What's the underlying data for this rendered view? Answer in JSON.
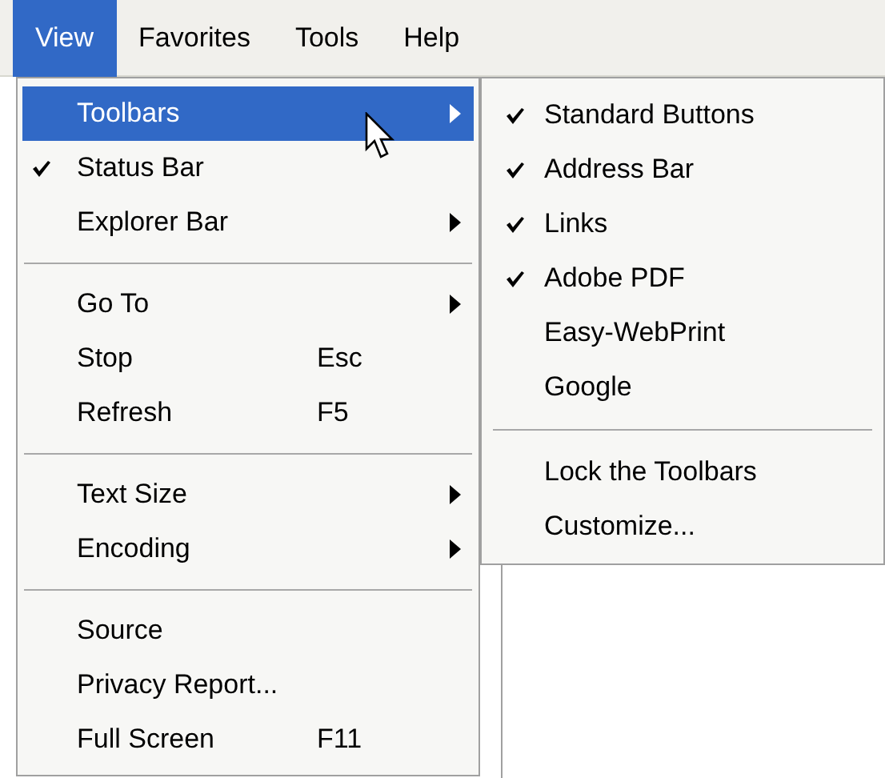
{
  "menubar": [
    {
      "label": "View",
      "selected": true
    },
    {
      "label": "Favorites",
      "selected": false
    },
    {
      "label": "Tools",
      "selected": false
    },
    {
      "label": "Help",
      "selected": false
    }
  ],
  "menu": {
    "sections": [
      [
        {
          "label": "Toolbars",
          "selected": true,
          "checked": false,
          "submenu": true
        },
        {
          "label": "Status Bar",
          "selected": false,
          "checked": true,
          "submenu": false
        },
        {
          "label": "Explorer Bar",
          "selected": false,
          "checked": false,
          "submenu": true
        }
      ],
      [
        {
          "label": "Go To",
          "selected": false,
          "checked": false,
          "submenu": true
        },
        {
          "label": "Stop",
          "shortcut": "Esc",
          "selected": false,
          "checked": false,
          "submenu": false
        },
        {
          "label": "Refresh",
          "shortcut": "F5",
          "selected": false,
          "checked": false,
          "submenu": false
        }
      ],
      [
        {
          "label": "Text Size",
          "selected": false,
          "checked": false,
          "submenu": true
        },
        {
          "label": "Encoding",
          "selected": false,
          "checked": false,
          "submenu": true
        }
      ],
      [
        {
          "label": "Source",
          "selected": false,
          "checked": false,
          "submenu": false
        },
        {
          "label": "Privacy Report...",
          "selected": false,
          "checked": false,
          "submenu": false
        },
        {
          "label": "Full Screen",
          "shortcut": "F11",
          "selected": false,
          "checked": false,
          "submenu": false
        }
      ]
    ]
  },
  "submenu": {
    "sections": [
      [
        {
          "label": "Standard Buttons",
          "checked": true
        },
        {
          "label": "Address Bar",
          "checked": true
        },
        {
          "label": "Links",
          "checked": true
        },
        {
          "label": "Adobe PDF",
          "checked": true
        },
        {
          "label": "Easy-WebPrint",
          "checked": false
        },
        {
          "label": "Google",
          "checked": false
        }
      ],
      [
        {
          "label": "Lock the Toolbars",
          "checked": false
        },
        {
          "label": "Customize...",
          "checked": false
        }
      ]
    ]
  }
}
